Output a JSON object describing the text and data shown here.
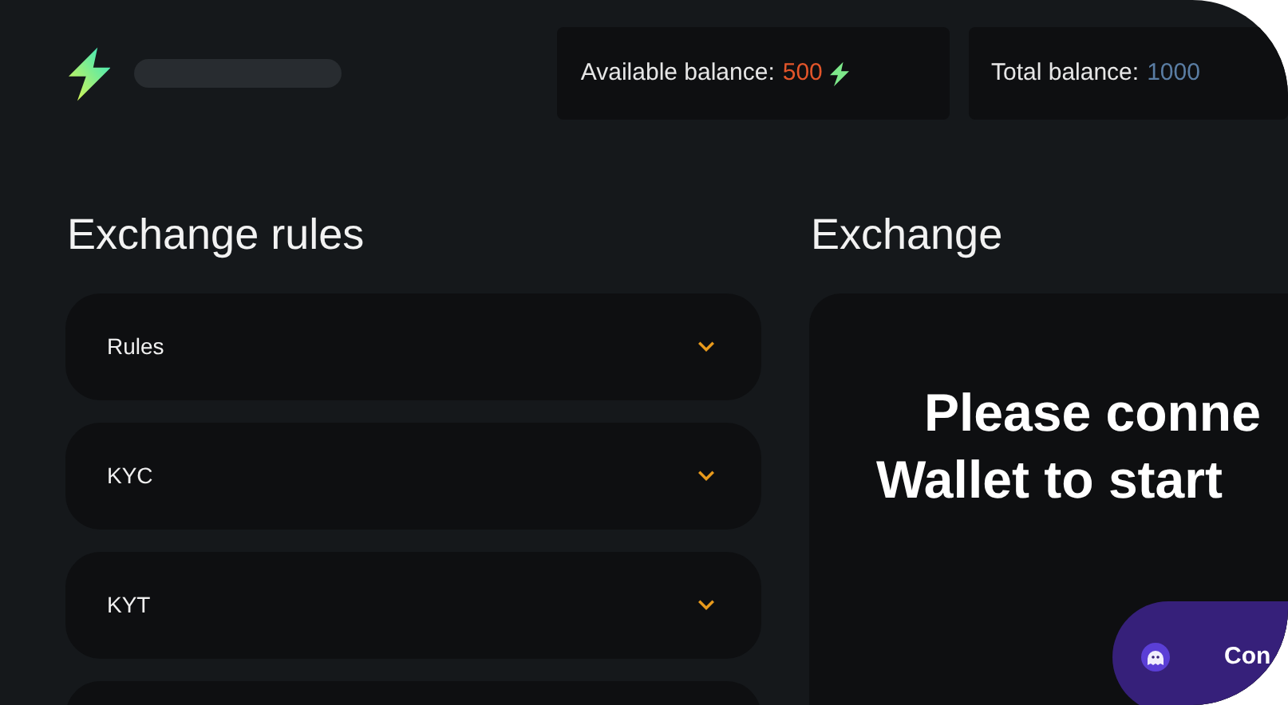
{
  "header": {
    "available_label": "Available balance:",
    "available_value": "500",
    "total_label": "Total balance:",
    "total_value": "1000"
  },
  "rules": {
    "title": "Exchange rules",
    "items": [
      {
        "label": "Rules",
        "expanded": false
      },
      {
        "label": "KYC",
        "expanded": false
      },
      {
        "label": "KYT",
        "expanded": false
      }
    ]
  },
  "exchange": {
    "title": "Exchange",
    "message_lines": [
      "Please conne",
      "Wallet to start"
    ],
    "button": "Con"
  }
}
